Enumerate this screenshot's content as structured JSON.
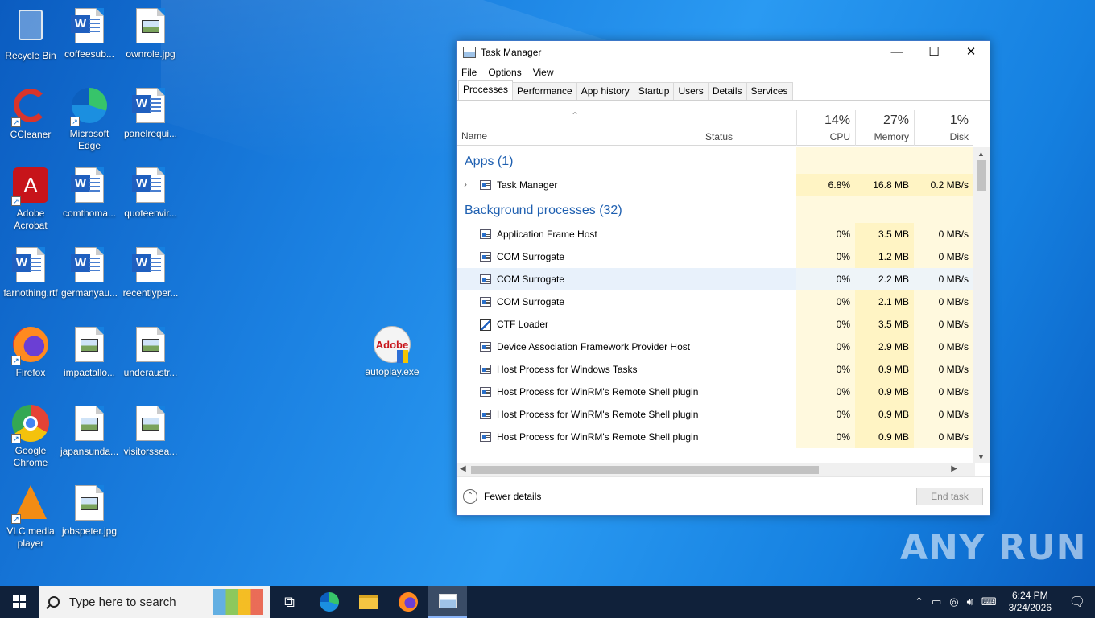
{
  "desktop": {
    "icons": [
      {
        "label": "Recycle Bin",
        "icon": "recycle-bin-icon"
      },
      {
        "label": "coffeesub...",
        "icon": "word-doc-icon"
      },
      {
        "label": "ownrole.jpg",
        "icon": "image-file-icon"
      },
      {
        "label": "CCleaner",
        "icon": "ccleaner-icon"
      },
      {
        "label": "Microsoft Edge",
        "icon": "edge-icon"
      },
      {
        "label": "panelrequi...",
        "icon": "word-doc-icon"
      },
      {
        "label": "Adobe Acrobat",
        "icon": "acrobat-icon"
      },
      {
        "label": "comthoma...",
        "icon": "word-doc-icon"
      },
      {
        "label": "quoteenvir...",
        "icon": "word-doc-icon"
      },
      {
        "label": "farnothing.rtf",
        "icon": "word-doc-icon"
      },
      {
        "label": "germanyau...",
        "icon": "word-doc-icon"
      },
      {
        "label": "recentlyper...",
        "icon": "word-doc-icon"
      },
      {
        "label": "Firefox",
        "icon": "firefox-icon"
      },
      {
        "label": "impactallo...",
        "icon": "image-file-icon"
      },
      {
        "label": "underaustr...",
        "icon": "image-file-icon"
      },
      {
        "label": "autoplay.exe",
        "icon": "adobe-installer-icon"
      },
      {
        "label": "Google Chrome",
        "icon": "chrome-icon"
      },
      {
        "label": "japansunda...",
        "icon": "image-file-icon"
      },
      {
        "label": "visitorssea...",
        "icon": "image-file-icon"
      },
      {
        "label": "VLC media player",
        "icon": "vlc-icon"
      },
      {
        "label": "jobspeter.jpg",
        "icon": "image-file-icon"
      }
    ]
  },
  "task_manager": {
    "title": "Task Manager",
    "menu": [
      "File",
      "Options",
      "View"
    ],
    "tabs": [
      "Processes",
      "Performance",
      "App history",
      "Startup",
      "Users",
      "Details",
      "Services"
    ],
    "active_tab": "Processes",
    "columns": {
      "name": "Name",
      "status": "Status",
      "cpu": {
        "percent": "14%",
        "label": "CPU"
      },
      "memory": {
        "percent": "27%",
        "label": "Memory"
      },
      "disk": {
        "percent": "1%",
        "label": "Disk"
      }
    },
    "groups": {
      "apps": "Apps (1)",
      "background": "Background processes (32)"
    },
    "apps": [
      {
        "name": "Task Manager",
        "cpu": "6.8%",
        "memory": "16.8 MB",
        "disk": "0.2 MB/s"
      }
    ],
    "background": [
      {
        "name": "Application Frame Host",
        "cpu": "0%",
        "memory": "3.5 MB",
        "disk": "0 MB/s"
      },
      {
        "name": "COM Surrogate",
        "cpu": "0%",
        "memory": "1.2 MB",
        "disk": "0 MB/s"
      },
      {
        "name": "COM Surrogate",
        "cpu": "0%",
        "memory": "2.2 MB",
        "disk": "0 MB/s"
      },
      {
        "name": "COM Surrogate",
        "cpu": "0%",
        "memory": "2.1 MB",
        "disk": "0 MB/s"
      },
      {
        "name": "CTF Loader",
        "cpu": "0%",
        "memory": "3.5 MB",
        "disk": "0 MB/s"
      },
      {
        "name": "Device Association Framework Provider Host",
        "cpu": "0%",
        "memory": "2.9 MB",
        "disk": "0 MB/s"
      },
      {
        "name": "Host Process for Windows Tasks",
        "cpu": "0%",
        "memory": "0.9 MB",
        "disk": "0 MB/s"
      },
      {
        "name": "Host Process for WinRM's Remote Shell plugin",
        "cpu": "0%",
        "memory": "0.9 MB",
        "disk": "0 MB/s"
      },
      {
        "name": "Host Process for WinRM's Remote Shell plugin",
        "cpu": "0%",
        "memory": "0.9 MB",
        "disk": "0 MB/s"
      },
      {
        "name": "Host Process for WinRM's Remote Shell plugin",
        "cpu": "0%",
        "memory": "0.9 MB",
        "disk": "0 MB/s"
      }
    ],
    "fewer_details": "Fewer details",
    "end_task": "End task"
  },
  "taskbar": {
    "search_placeholder": "Type here to search",
    "time": "6:24 PM",
    "date": "3/24/2026"
  },
  "watermark": "ANY RUN"
}
